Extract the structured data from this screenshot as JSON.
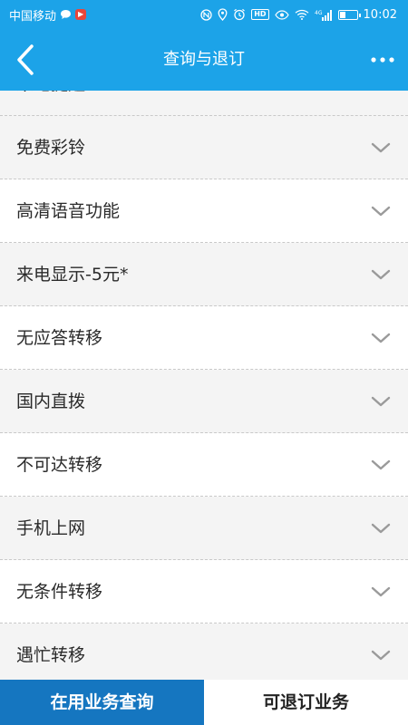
{
  "status_bar": {
    "carrier": "中国移动",
    "time": "10:02",
    "icons": [
      "message-icon",
      "app-icon",
      "nfc-icon",
      "location-icon",
      "alarm-icon",
      "hd-icon",
      "eye-icon",
      "wifi-icon",
      "signal-icon",
      "battery-icon"
    ],
    "hd_label": "HD",
    "signal_label": "4G"
  },
  "header": {
    "title": "查询与退订",
    "back_icon": "chevron-left-icon",
    "more_icon": "more-icon"
  },
  "list": {
    "items": [
      {
        "label": "来电提醒"
      },
      {
        "label": "免费彩铃"
      },
      {
        "label": "高清语音功能"
      },
      {
        "label": "来电显示-5元*"
      },
      {
        "label": "无应答转移"
      },
      {
        "label": "国内直拨"
      },
      {
        "label": "不可达转移"
      },
      {
        "label": "手机上网"
      },
      {
        "label": "无条件转移"
      },
      {
        "label": "遇忙转移"
      }
    ]
  },
  "tabs": [
    {
      "label": "在用业务查询",
      "active": true
    },
    {
      "label": "可退订业务",
      "active": false
    }
  ],
  "colors": {
    "header_blue": "#1ca3e8",
    "active_tab": "#1576c0"
  }
}
